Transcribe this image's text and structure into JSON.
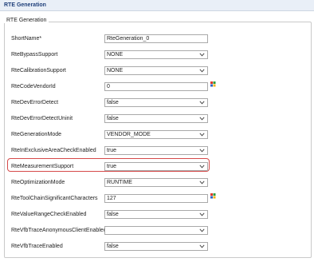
{
  "header": {
    "title": "RTE Generation"
  },
  "group": {
    "legend": "RTE Generation"
  },
  "rows": [
    {
      "label": "ShortName*",
      "type": "text",
      "value": "RteGeneration_0"
    },
    {
      "label": "RteBypassSupport",
      "type": "select",
      "value": "NONE"
    },
    {
      "label": "RteCalibrationSupport",
      "type": "select",
      "value": "NONE"
    },
    {
      "label": "RteCodeVendorId",
      "type": "text",
      "value": "0",
      "icon": "parameter-cube-icon"
    },
    {
      "label": "RteDevErrorDetect",
      "type": "select",
      "value": "false"
    },
    {
      "label": "RteDevErrorDetectUninit",
      "type": "select",
      "value": "false"
    },
    {
      "label": "RteGenerationMode",
      "type": "select",
      "value": "VENDOR_MODE"
    },
    {
      "label": "RteInExclusiveAreaCheckEnabled",
      "type": "select",
      "value": "true"
    },
    {
      "label": "RteMeasurementSupport",
      "type": "select",
      "value": "true",
      "highlighted": true
    },
    {
      "label": "RteOptimizationMode",
      "type": "select",
      "value": "RUNTIME"
    },
    {
      "label": "RteToolChainSignificantCharacters",
      "type": "text",
      "value": "127",
      "icon": "parameter-cube-icon"
    },
    {
      "label": "RteValueRangeCheckEnabled",
      "type": "select",
      "value": "false"
    },
    {
      "label": "RteVfbTraceAnonymousClientEnabled",
      "type": "select",
      "value": ""
    },
    {
      "label": "RteVfbTraceEnabled",
      "type": "select",
      "value": "false"
    }
  ],
  "colors": {
    "highlight": "#d64a4a",
    "header_text": "#1f3f7a"
  }
}
